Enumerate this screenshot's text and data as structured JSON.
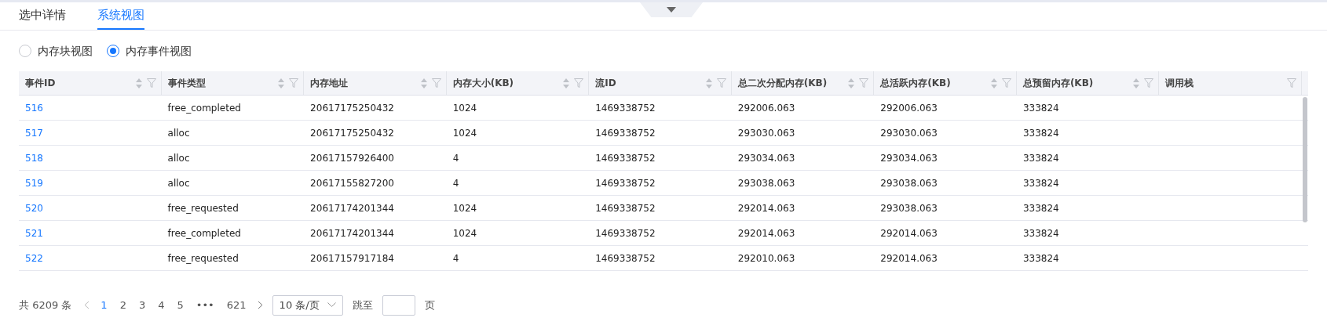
{
  "tabs": [
    {
      "label": "选中详情",
      "selected": false
    },
    {
      "label": "系统视图",
      "selected": true
    }
  ],
  "view_options": [
    {
      "label": "内存块视图",
      "selected": false
    },
    {
      "label": "内存事件视图",
      "selected": true
    }
  ],
  "table": {
    "columns": [
      "事件ID",
      "事件类型",
      "内存地址",
      "内存大小(KB)",
      "流ID",
      "总二次分配内存(KB)",
      "总活跃内存(KB)",
      "总预留内存(KB)",
      "调用栈"
    ],
    "sortable": [
      true,
      true,
      true,
      true,
      true,
      true,
      true,
      true,
      false
    ],
    "rows": [
      [
        "516",
        "free_completed",
        "20617175250432",
        "1024",
        "1469338752",
        "292006.063",
        "292006.063",
        "333824"
      ],
      [
        "517",
        "alloc",
        "20617175250432",
        "1024",
        "1469338752",
        "293030.063",
        "293030.063",
        "333824"
      ],
      [
        "518",
        "alloc",
        "20617157926400",
        "4",
        "1469338752",
        "293034.063",
        "293034.063",
        "333824"
      ],
      [
        "519",
        "alloc",
        "20617155827200",
        "4",
        "1469338752",
        "293038.063",
        "293038.063",
        "333824"
      ],
      [
        "520",
        "free_requested",
        "20617174201344",
        "1024",
        "1469338752",
        "292014.063",
        "293038.063",
        "333824"
      ],
      [
        "521",
        "free_completed",
        "20617174201344",
        "1024",
        "1469338752",
        "292014.063",
        "292014.063",
        "333824"
      ],
      [
        "522",
        "free_requested",
        "20617157917184",
        "4",
        "1469338752",
        "292010.063",
        "292014.063",
        "333824"
      ]
    ]
  },
  "pagination": {
    "total": "共 6209 条",
    "pages": [
      {
        "label": "1",
        "selected": true
      },
      {
        "label": "2",
        "selected": false
      },
      {
        "label": "3",
        "selected": false
      },
      {
        "label": "4",
        "selected": false
      },
      {
        "label": "5",
        "selected": false
      },
      {
        "label": "•••",
        "selected": false
      },
      {
        "label": "621",
        "selected": false
      }
    ],
    "page_size": "10 条/页",
    "jump_label": "跳至",
    "page_unit": "页"
  }
}
